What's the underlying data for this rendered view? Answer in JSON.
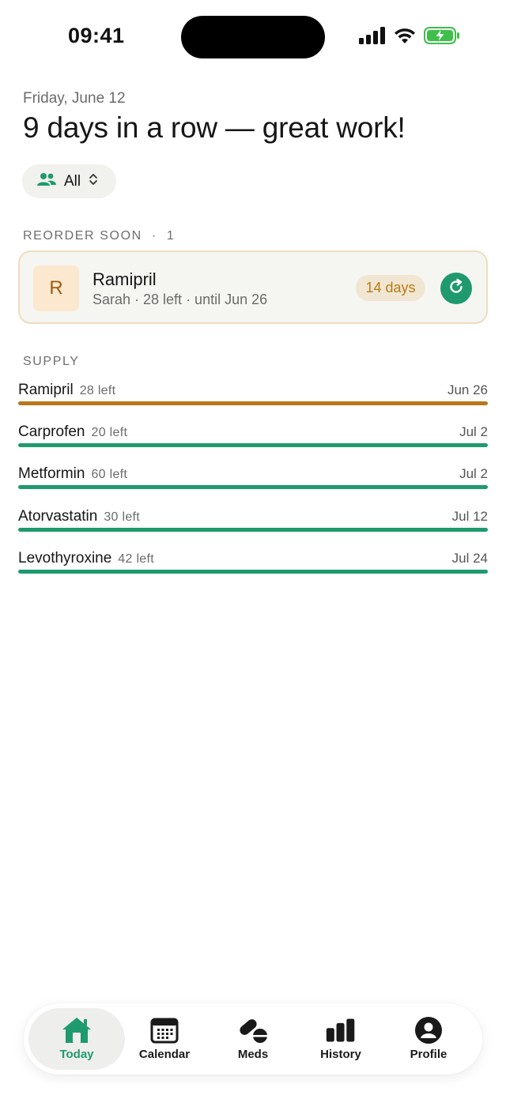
{
  "status_bar": {
    "time": "09:41"
  },
  "header": {
    "date": "Friday, June 12",
    "headline": "9 days in a row — great work!"
  },
  "filter": {
    "label": "All"
  },
  "reorder": {
    "section_label": "REORDER SOON",
    "count": "1",
    "item": {
      "initial": "R",
      "name": "Ramipril",
      "subtitle": "Sarah · 28 left · until Jun 26",
      "days_badge": "14 days"
    }
  },
  "supply": {
    "section_label": "SUPPLY",
    "items": [
      {
        "name": "Ramipril",
        "left": "28 left",
        "date": "Jun 26",
        "color": "#b8781c"
      },
      {
        "name": "Carprofen",
        "left": "20 left",
        "date": "Jul 2",
        "color": "#1f9a6e"
      },
      {
        "name": "Metformin",
        "left": "60 left",
        "date": "Jul 2",
        "color": "#1f9a6e"
      },
      {
        "name": "Atorvastatin",
        "left": "30 left",
        "date": "Jul 12",
        "color": "#1f9a6e"
      },
      {
        "name": "Levothyroxine",
        "left": "42 left",
        "date": "Jul 24",
        "color": "#1f9a6e"
      }
    ]
  },
  "tabs": [
    {
      "label": "Today",
      "icon": "home-icon",
      "active": true
    },
    {
      "label": "Calendar",
      "icon": "calendar-icon",
      "active": false
    },
    {
      "label": "Meds",
      "icon": "pills-icon",
      "active": false
    },
    {
      "label": "History",
      "icon": "bar-chart-icon",
      "active": false
    },
    {
      "label": "Profile",
      "icon": "profile-icon",
      "active": false
    }
  ],
  "colors": {
    "accent": "#1f9a6e",
    "warning": "#b8781c",
    "badge_bg": "#f1e6d1"
  }
}
